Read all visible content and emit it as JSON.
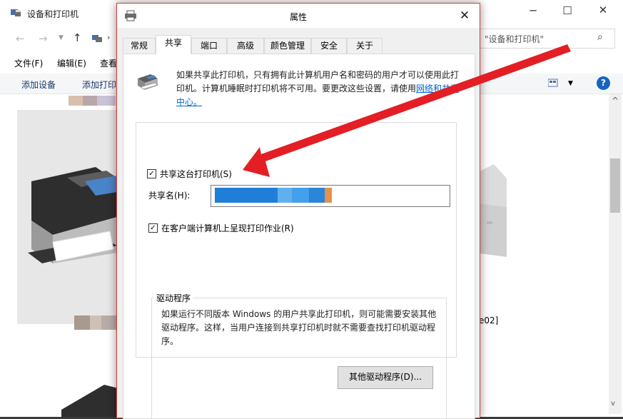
{
  "explorer": {
    "title": "设备和打印机",
    "search_placeholder": "\"设备和打印机\"",
    "menu": [
      "文件(F)",
      "编辑(E)",
      "查看"
    ],
    "commands": [
      "添加设备",
      "添加打印"
    ],
    "device_label_fragment": "e02]"
  },
  "dialog": {
    "title": "属性",
    "tabs": [
      "常规",
      "共享",
      "端口",
      "高级",
      "颜色管理",
      "安全",
      "关于"
    ],
    "active_tab": "共享",
    "info_text": "如果共享此打印机，只有拥有此计算机用户名和密码的用户才可以使用此打印机。计算机睡眠时打印机将不可用。要更改这些设置，请使用",
    "info_link": "网络和共享中心。",
    "share_checkbox_label": "共享这台打印机(S)",
    "share_checked": true,
    "share_name_label": "共享名(H):",
    "render_checkbox_label": "在客户端计算机上呈现打印作业(R)",
    "render_checked": true,
    "driver_group_title": "驱动程序",
    "driver_text": "如果运行不同版本 Windows 的用户共享此打印机，则可能需要安装其他驱动程序。这样，当用户连接到共享打印机时就不需要查找打印机驱动程序。",
    "driver_button": "其他驱动程序(D)..."
  },
  "colors": {
    "arrow": "#e31e24",
    "link": "#0066cc",
    "dialog_border": "#e03a3a",
    "share_name_redaction": "#1f7fd8"
  }
}
